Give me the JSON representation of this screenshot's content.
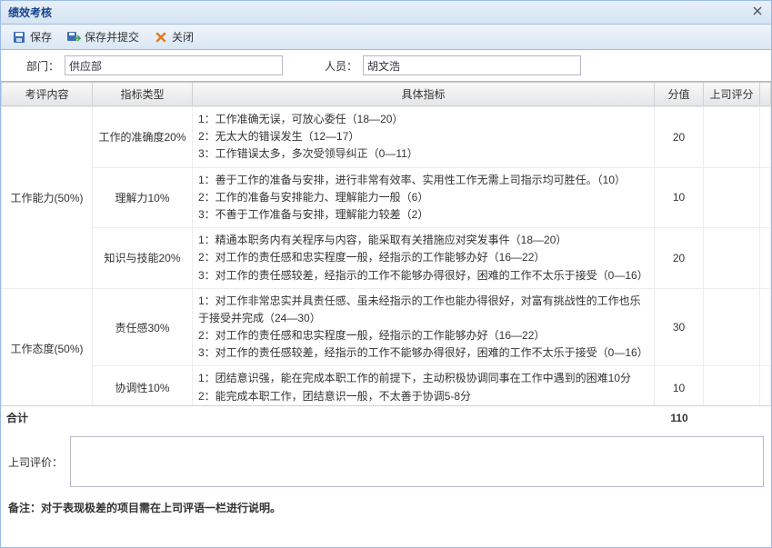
{
  "window": {
    "title": "绩效考核",
    "close_icon": "close"
  },
  "toolbar": {
    "save": "保存",
    "save_submit": "保存并提交",
    "close": "关闭"
  },
  "form": {
    "dept_label": "部门：",
    "dept_value": "供应部",
    "person_label": "人员：",
    "person_value": "胡文浩"
  },
  "columns": {
    "c1": "考评内容",
    "c2": "指标类型",
    "c3": "具体指标",
    "c4": "分值",
    "c5": "上司评分",
    "c6": ""
  },
  "rows": [
    {
      "cat": "工作能力(50%)",
      "type": "工作的准确度20%",
      "detail": "1：工作准确无误，可放心委任（18—20）\n2：无太大的错误发生（12—17）\n3：工作错误太多，多次受领导纠正（0—11）",
      "score": "20"
    },
    {
      "cat": "",
      "type": "理解力10%",
      "detail": "1：善于工作的准备与安排，进行非常有效率、实用性工作无需上司指示均可胜任。（10）\n2：工作的准备与安排能力、理解能力一般（6）\n3：不善于工作准备与安排，理解能力较差（2）",
      "score": "10"
    },
    {
      "cat": "",
      "type": "知识与技能20%",
      "detail": "1：精通本职务内有关程序与内容，能采取有关措施应对突发事件（18—20）\n2：对工作的责任感和忠实程度一般，经指示的工作能够办好（16—22）\n3：对工作的责任感较差，经指示的工作不能够办得很好，困难的工作不太乐于接受（0—16）",
      "score": "20"
    },
    {
      "cat": "工作态度(50%)",
      "type": "责任感30%",
      "detail": "1：对工作非常忠实并具责任感、虽未经指示的工作也能办得很好，对富有挑战性的工作也乐于接受并完成（24—30）\n2：对工作的责任感和忠实程度一般，经指示的工作能够办好（16—22）\n3：对工作的责任感较差，经指示的工作不能够办得很好，困难的工作不太乐于接受（0—16）",
      "score": "30"
    },
    {
      "cat": "",
      "type": "协调性10%",
      "detail": "1：团结意识强，能在完成本职工作的前提下，主动积极协调同事在工作中遇到的困难10分\n2：能完成本职工作，团结意识一般，不太善于协调5-8分",
      "score": "10"
    }
  ],
  "totals": {
    "label": "合计",
    "value": "110"
  },
  "comment": {
    "label": "上司评价：",
    "value": ""
  },
  "note": "备注：对于表现极差的项目需在上司评语一栏进行说明。"
}
